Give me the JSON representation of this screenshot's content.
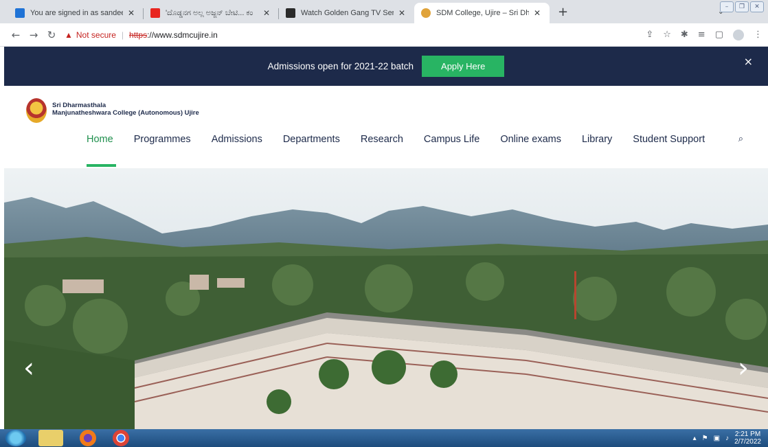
{
  "browser": {
    "tabs": [
      {
        "title": "You are signed in as sandeep.l",
        "favicon_color": "#1f73d6",
        "favicon_icon": "s-icon"
      },
      {
        "title": "'ದೊಡ್ಡನಗ ಅಲ್ಲ ಅಜ್ಜನ್ ಬೇಟಿ... ಕಂ",
        "favicon_color": "#e8251f",
        "favicon_icon": "youtube-icon"
      },
      {
        "title": "Watch Golden Gang TV Serie",
        "favicon_color": "#2a2a2a",
        "favicon_icon": "tv-icon"
      },
      {
        "title": "SDM College, Ujire – Sri Dharma",
        "favicon_color": "#e0a33a",
        "favicon_icon": "college-icon"
      }
    ],
    "active_tab_index": 3,
    "new_tab_label": "+",
    "address": {
      "security_label": "Not secure",
      "scheme": "https",
      "host": "://www.sdmcujire.in"
    }
  },
  "banner": {
    "text": "Admissions open for 2021-22 batch",
    "button_label": "Apply Here",
    "close_label": "×",
    "bg": "#1d2a4a",
    "button_color": "#28b463"
  },
  "header": {
    "brand_line1": "Sri Dharmasthala",
    "brand_line2": "Manjunatheshwara College (Autonomous) Ujire",
    "menu": [
      {
        "label": "Home",
        "active": true
      },
      {
        "label": "Programmes"
      },
      {
        "label": "Admissions"
      },
      {
        "label": "Departments"
      },
      {
        "label": "Research"
      },
      {
        "label": "Campus Life"
      },
      {
        "label": "Online exams"
      },
      {
        "label": "Library"
      },
      {
        "label": "Student Support"
      }
    ],
    "accent": "#28b463"
  },
  "hero": {
    "prev_label": "‹",
    "next_label": "›"
  },
  "taskbar": {
    "time": "2:21 PM",
    "date": "2/7/2022"
  }
}
